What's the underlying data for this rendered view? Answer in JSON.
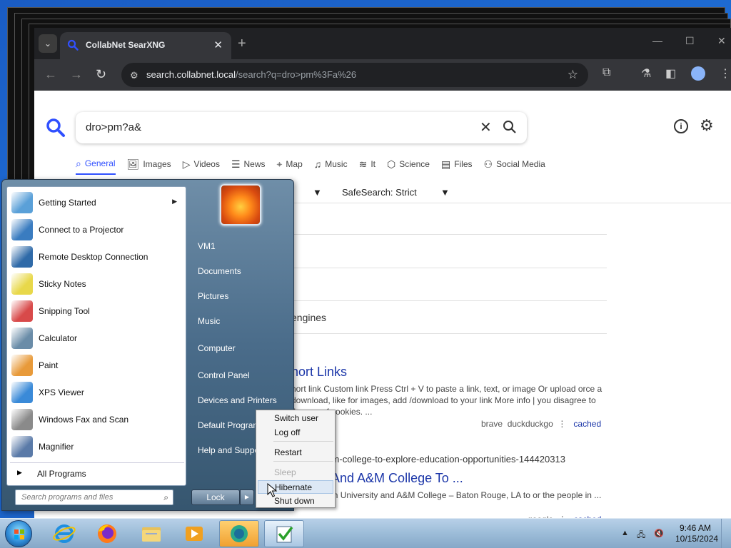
{
  "browser": {
    "tab_title": "CollabNet SearXNG",
    "url_host": "search.collabnet.local",
    "url_path": "/search?q=dro>pm%3Fa%26"
  },
  "page": {
    "query": "dro>pm?a&",
    "categories": [
      {
        "label": "General",
        "icon": "search-icon",
        "active": true
      },
      {
        "label": "Images",
        "icon": "image-icon"
      },
      {
        "label": "Videos",
        "icon": "play-icon"
      },
      {
        "label": "News",
        "icon": "newspaper-icon"
      },
      {
        "label": "Map",
        "icon": "map-pin-icon"
      },
      {
        "label": "Music",
        "icon": "music-icon"
      },
      {
        "label": "It",
        "icon": "layers-icon"
      },
      {
        "label": "Science",
        "icon": "cube-icon"
      },
      {
        "label": "Files",
        "icon": "folder-icon"
      },
      {
        "label": "Social Media",
        "icon": "people-icon"
      }
    ],
    "filter_time_fragment": "e",
    "safesearch": "SafeSearch: Strict",
    "engines_fragment": "engines",
    "result1": {
      "title": "hort Links",
      "snippet": "hort link Custom link Press Ctrl + V to paste a link, text, or image Or upload orce a download, like for images, add /download to your link More info | you disagree to the use of cookies. ...",
      "engine_a": "brave",
      "engine_b": "duckduckgo",
      "cached": "cached"
    },
    "result2": {
      "url": "-am-college-to-explore-education-opportunities-144420313",
      "title": "versity And A&M College To ...",
      "snippet": "he Southern University and A&M College – Baton Rouge, LA to or the people in ...",
      "engine": "google",
      "cached": "cached"
    }
  },
  "start_menu": {
    "apps": [
      {
        "label": "Getting Started",
        "icon": "getting-started-icon",
        "color": "#5aa0d8",
        "submenu": true
      },
      {
        "label": "Connect to a Projector",
        "icon": "projector-icon",
        "color": "#3a7cc0"
      },
      {
        "label": "Remote Desktop Connection",
        "icon": "remote-desktop-icon",
        "color": "#2f6aa8"
      },
      {
        "label": "Sticky Notes",
        "icon": "sticky-notes-icon",
        "color": "#e8d84a"
      },
      {
        "label": "Snipping Tool",
        "icon": "snipping-tool-icon",
        "color": "#d84a4a"
      },
      {
        "label": "Calculator",
        "icon": "calculator-icon",
        "color": "#6a8ca8"
      },
      {
        "label": "Paint",
        "icon": "paint-icon",
        "color": "#e89a3a"
      },
      {
        "label": "XPS Viewer",
        "icon": "xps-viewer-icon",
        "color": "#3a8ad8"
      },
      {
        "label": "Windows Fax and Scan",
        "icon": "fax-scan-icon",
        "color": "#8a8a8a"
      },
      {
        "label": "Magnifier",
        "icon": "magnifier-icon",
        "color": "#5a7aa8"
      }
    ],
    "all_programs": "All Programs",
    "search_placeholder": "Search programs and files",
    "right_items": [
      "VM1",
      "Documents",
      "Pictures",
      "Music",
      "Computer",
      "Control Panel",
      "Devices and Printers",
      "Default Programs",
      "Help and Support"
    ],
    "lock": "Lock"
  },
  "power_menu": {
    "items": [
      "Switch user",
      "Log off",
      "Restart",
      "Sleep",
      "Hibernate",
      "Shut down"
    ]
  },
  "taskbar": {
    "time": "9:46 AM",
    "date": "10/15/2024"
  },
  "colors": {
    "accent": "#3050ff",
    "link": "#1a35a8"
  }
}
